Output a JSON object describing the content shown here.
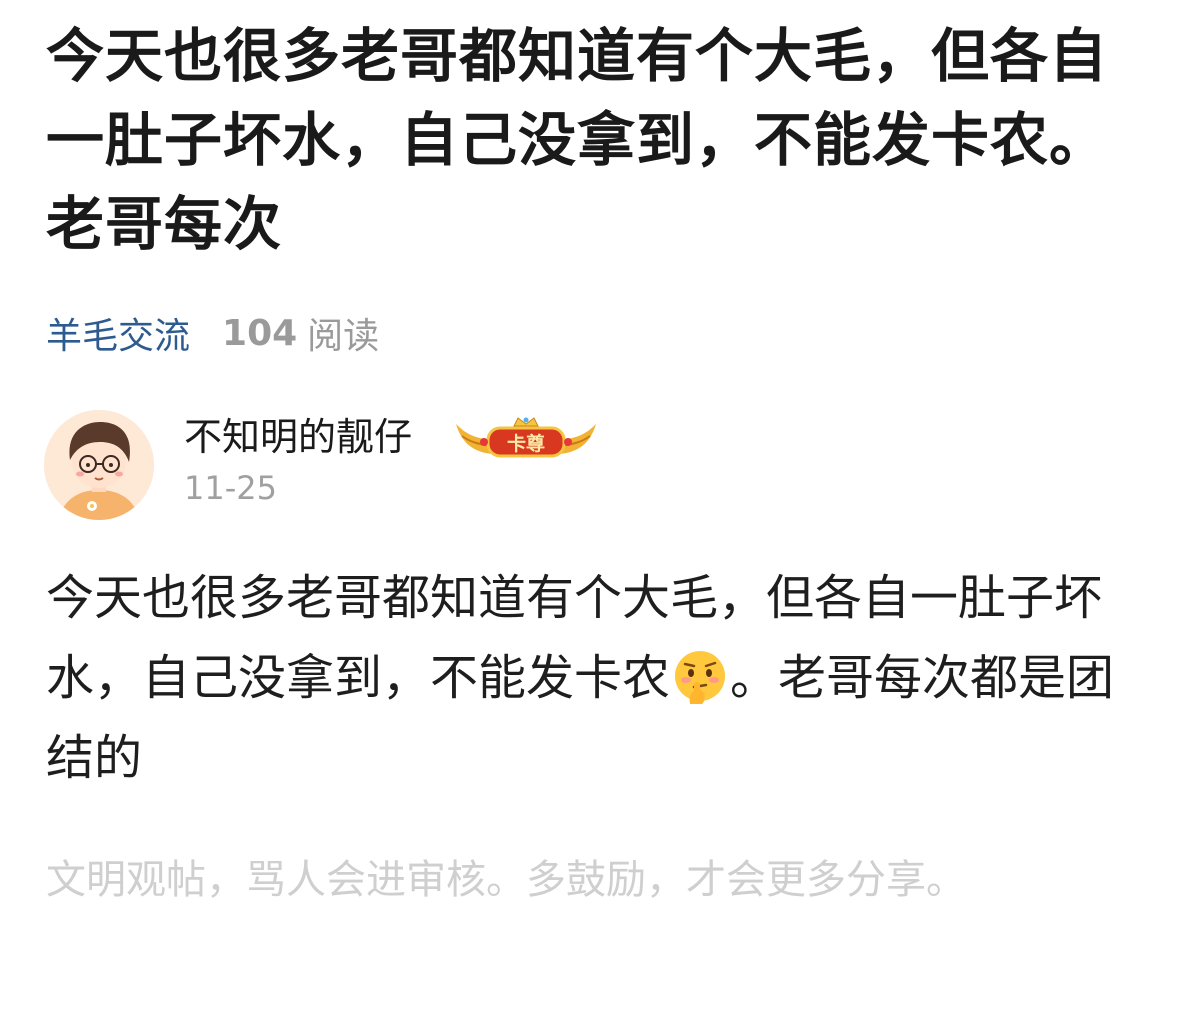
{
  "post": {
    "title": "今天也很多老哥都知道有个大毛，但各自一肚子坏水，自己没拿到，不能发卡农。老哥每次",
    "category": "羊毛交流",
    "read_count": "104",
    "read_unit": "阅读"
  },
  "author": {
    "name": "不知明的靓仔",
    "badge_text": "卡尊",
    "date": "11-25"
  },
  "content": {
    "text_before_emoji": "今天也很多老哥都知道有个大毛，但各自一肚子坏水，自己没拿到，不能发卡农",
    "emoji": "thinking-face-icon",
    "text_after_emoji": "。老哥每次都是团结的"
  },
  "footer": {
    "notice": "文明观帖，骂人会进审核。多鼓励，才会更多分享。"
  }
}
